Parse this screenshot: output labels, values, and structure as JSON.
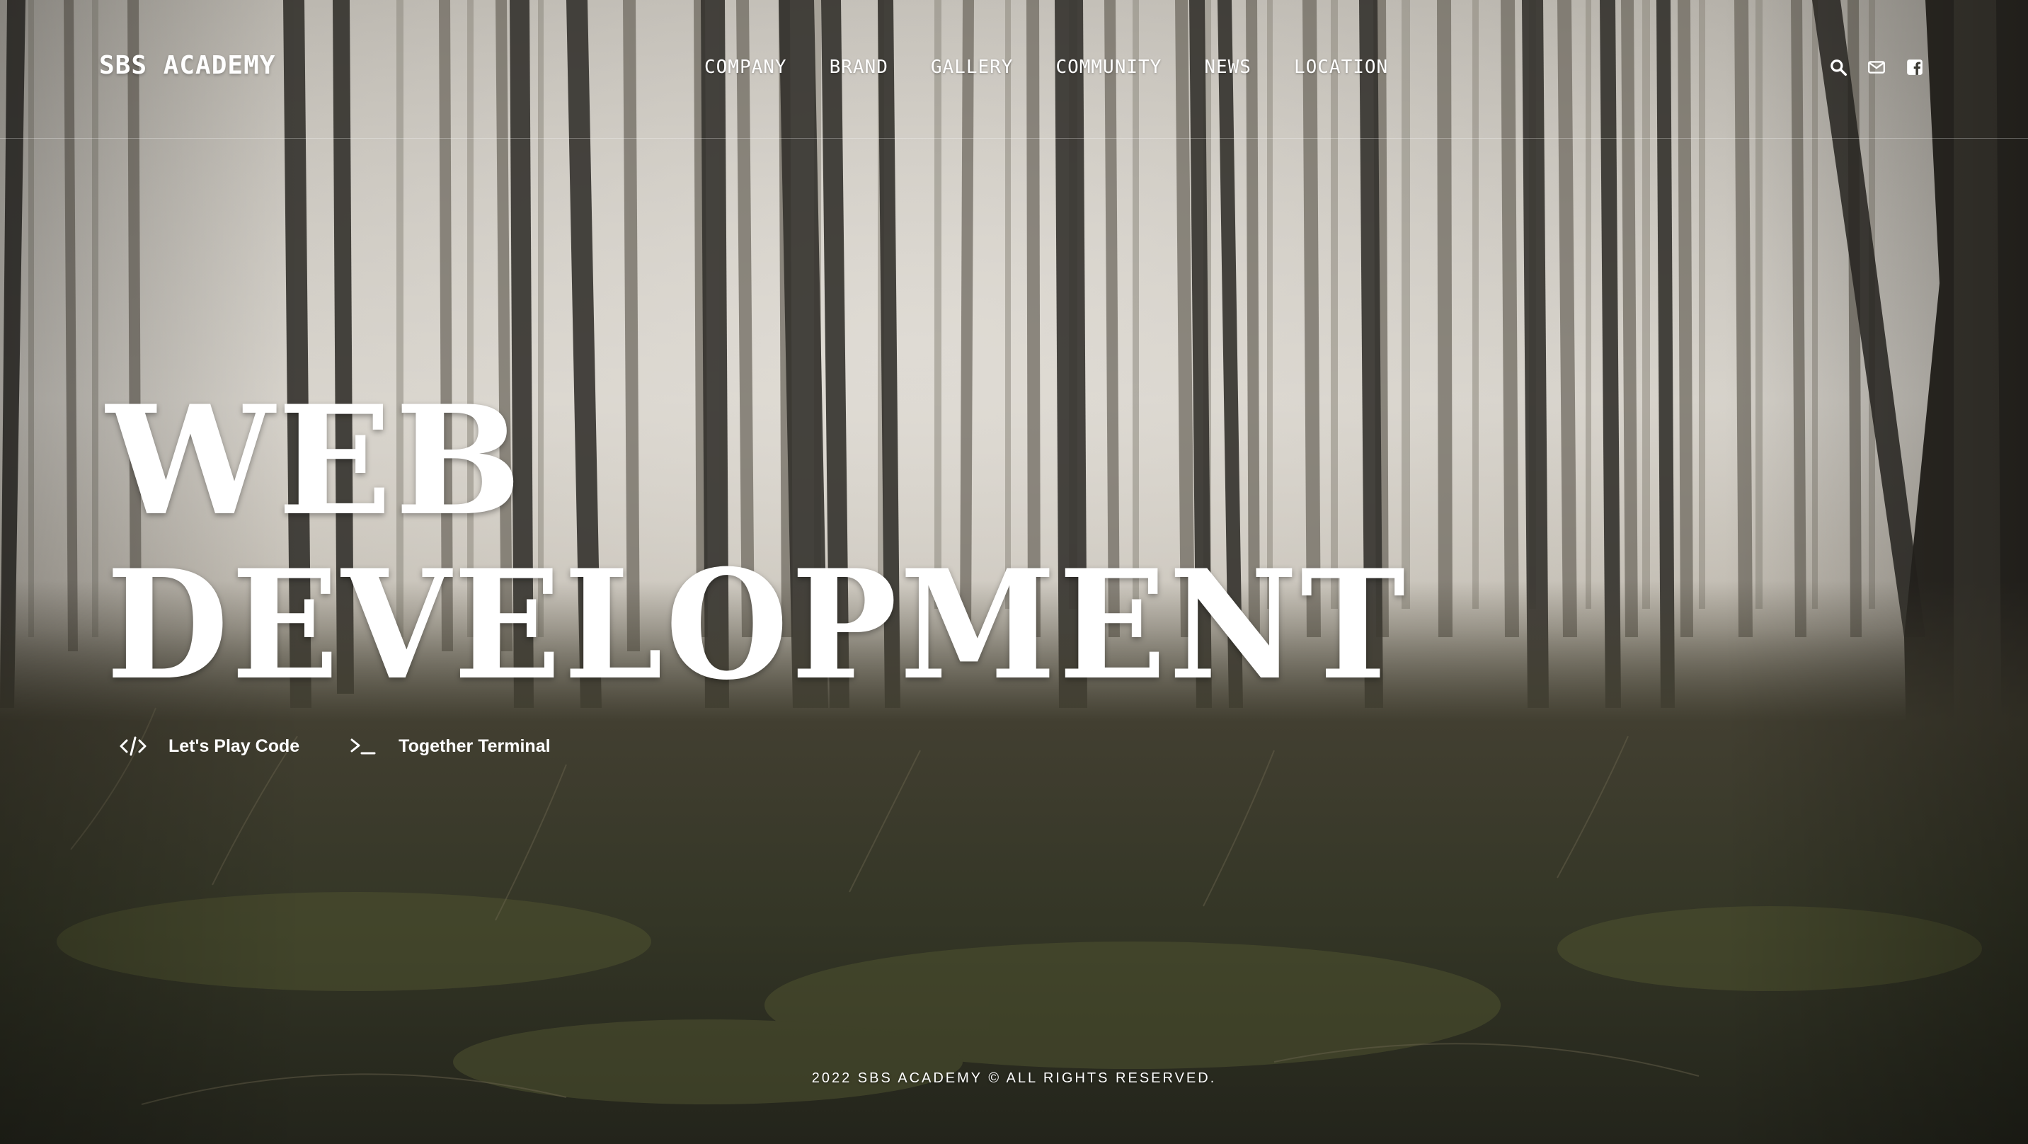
{
  "header": {
    "logo": "SBS ACADEMY",
    "nav": [
      "COMPANY",
      "BRAND",
      "GALLERY",
      "COMMUNITY",
      "NEWS",
      "LOCATION"
    ],
    "icons": [
      "search-icon",
      "mail-icon",
      "facebook-icon"
    ]
  },
  "hero": {
    "title_line_1": "WEB",
    "title_line_2": "DEVELOPMENT",
    "actions": [
      {
        "label": "Let's Play Code",
        "icon": "code-icon"
      },
      {
        "label": "Together Terminal",
        "icon": "terminal-icon"
      }
    ]
  },
  "footer": {
    "copyright": "2022 SBS ACADEMY © ALL RIGHTS RESERVED."
  },
  "colors": {
    "text": "#ffffff",
    "fog": "#d7d3cc",
    "ground": "#3b3a2c"
  }
}
